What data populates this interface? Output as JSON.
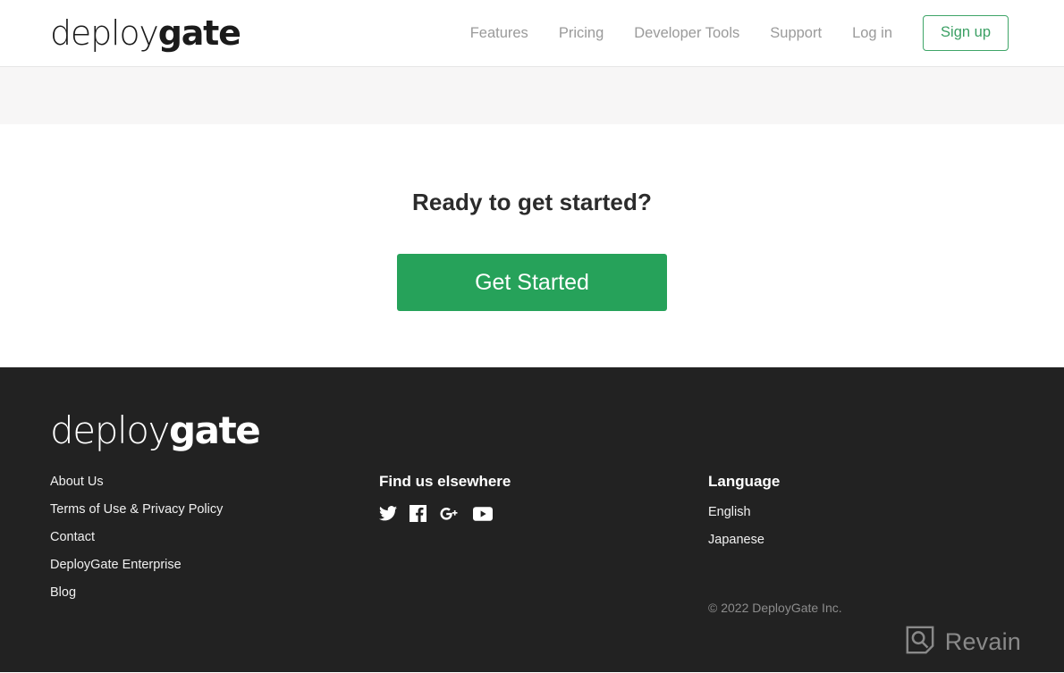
{
  "header": {
    "logo": {
      "light": "deploy",
      "bold": "gate",
      "name": "deploygate"
    },
    "nav": [
      {
        "label": "Features",
        "name": "nav-link-features"
      },
      {
        "label": "Pricing",
        "name": "nav-link-pricing"
      },
      {
        "label": "Developer Tools",
        "name": "nav-link-developer-tools"
      },
      {
        "label": "Support",
        "name": "nav-link-support"
      },
      {
        "label": "Log in",
        "name": "nav-link-log-in"
      }
    ],
    "signup_label": "Sign up"
  },
  "cta": {
    "heading": "Ready to get started?",
    "button_label": "Get Started"
  },
  "footer": {
    "logo": {
      "light": "deploy",
      "bold": "gate",
      "name": "deploygate"
    },
    "links": [
      {
        "label": "About Us"
      },
      {
        "label": "Terms of Use & Privacy Policy"
      },
      {
        "label": "Contact"
      },
      {
        "label": "DeployGate Enterprise"
      },
      {
        "label": "Blog"
      }
    ],
    "social_heading": "Find us elsewhere",
    "social": [
      {
        "label": "Twitter",
        "icon": "twitter-icon"
      },
      {
        "label": "Facebook",
        "icon": "facebook-icon"
      },
      {
        "label": "Google Plus",
        "icon": "google-plus-icon"
      },
      {
        "label": "YouTube",
        "icon": "youtube-icon"
      }
    ],
    "language_heading": "Language",
    "languages": [
      {
        "label": "English"
      },
      {
        "label": "Japanese"
      }
    ],
    "copyright": "© 2022 DeployGate Inc."
  },
  "watermark": {
    "text": "Revain",
    "icon": "revain-logo-icon"
  },
  "colors": {
    "brand_green": "#26a25a",
    "signup_green": "#3a9f63",
    "footer_bg": "#222222",
    "band_gray": "#f7f6f6",
    "nav_gray": "#9a9a9a"
  }
}
